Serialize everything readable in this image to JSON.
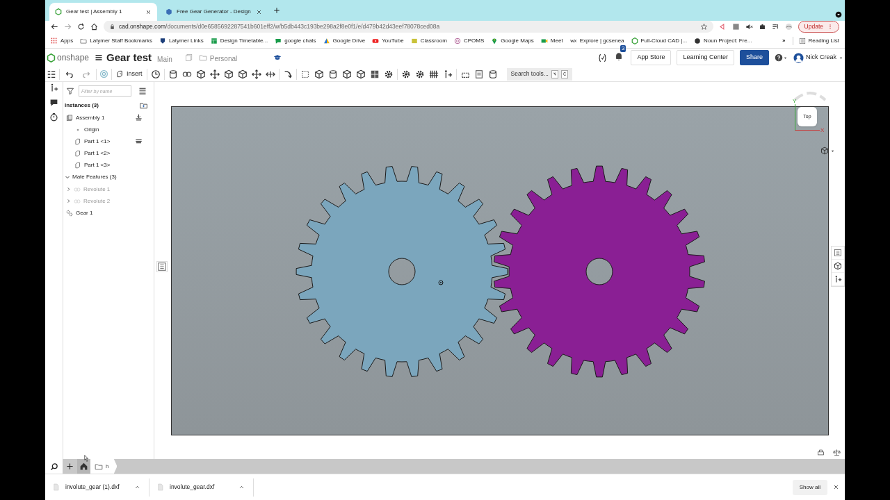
{
  "browser": {
    "tabs": [
      {
        "title": "Gear test | Assembly 1",
        "selected": true
      },
      {
        "title": "Free Gear Generator - Design ",
        "selected": false
      }
    ],
    "address": {
      "host": "cad.onshape.com",
      "path": "/documents/d0e6585692287541b601eff2/w/b5db443c193be298a2f8e0f1/e/d479b42d43eef78078ced08a"
    },
    "update_button": "Update",
    "bookmarks": [
      {
        "label": "Apps"
      },
      {
        "label": "Latymer Staff Bookmarks"
      },
      {
        "label": "Latymer Links"
      },
      {
        "label": "Design Timetable..."
      },
      {
        "label": "google chats"
      },
      {
        "label": "Google Drive"
      },
      {
        "label": "YouTube"
      },
      {
        "label": "Classroom"
      },
      {
        "label": "CPOMS"
      },
      {
        "label": "Google Maps"
      },
      {
        "label": "Meet"
      },
      {
        "label": "Explore | gcsenea"
      },
      {
        "label": "Full-Cloud CAD |..."
      },
      {
        "label": "Noun Project: Fre..."
      }
    ],
    "bookmarks_overflow": "»",
    "reading_list": "Reading List"
  },
  "header": {
    "logo_text": "onshape",
    "document_title": "Gear test",
    "branch": "Main",
    "folder": "Personal",
    "notification_count": "3",
    "buttons": [
      "App Store",
      "Learning Center",
      "Share"
    ],
    "user": "Nick Creak"
  },
  "toolbar": {
    "insert": "Insert",
    "search": {
      "placeholder": "Search tools...",
      "keys": [
        "⌥",
        "C"
      ]
    }
  },
  "panel": {
    "filter_placeholder": "Filter by name",
    "sections": [
      {
        "label": "Instances (3)",
        "kind": "list",
        "items": [
          {
            "label": "Assembly 1",
            "kind": "assembly",
            "disabled": false,
            "children": [
              {
                "label": "Origin",
                "kind": "origin",
                "disabled": false
              },
              {
                "label": "Part 1 <1>",
                "kind": "part",
                "disabled": false,
                "fixed": true
              },
              {
                "label": "Part 1 <2>",
                "kind": "part",
                "disabled": false
              },
              {
                "label": "Part 1 <3>",
                "kind": "part",
                "disabled": false
              }
            ]
          }
        ]
      },
      {
        "label": "Mate Features (3)",
        "kind": "group",
        "expanded": true,
        "items": [
          {
            "label": "Revolute 1",
            "kind": "mate",
            "disabled": true,
            "expanded": false
          },
          {
            "label": "Revolute 2",
            "kind": "mate",
            "disabled": true,
            "expanded": false
          },
          {
            "label": "Gear 1",
            "kind": "gear",
            "disabled": false
          }
        ]
      }
    ]
  },
  "view_cube": {
    "face": "Top",
    "x_axis": "X",
    "y_axis": "Y"
  },
  "bottom_bar": {
    "breadcrumb": "h"
  },
  "downloads": {
    "files": [
      {
        "name": "involute_gear (1).dxf"
      },
      {
        "name": "involute_gear.dxf"
      }
    ],
    "show_all": "Show all"
  }
}
